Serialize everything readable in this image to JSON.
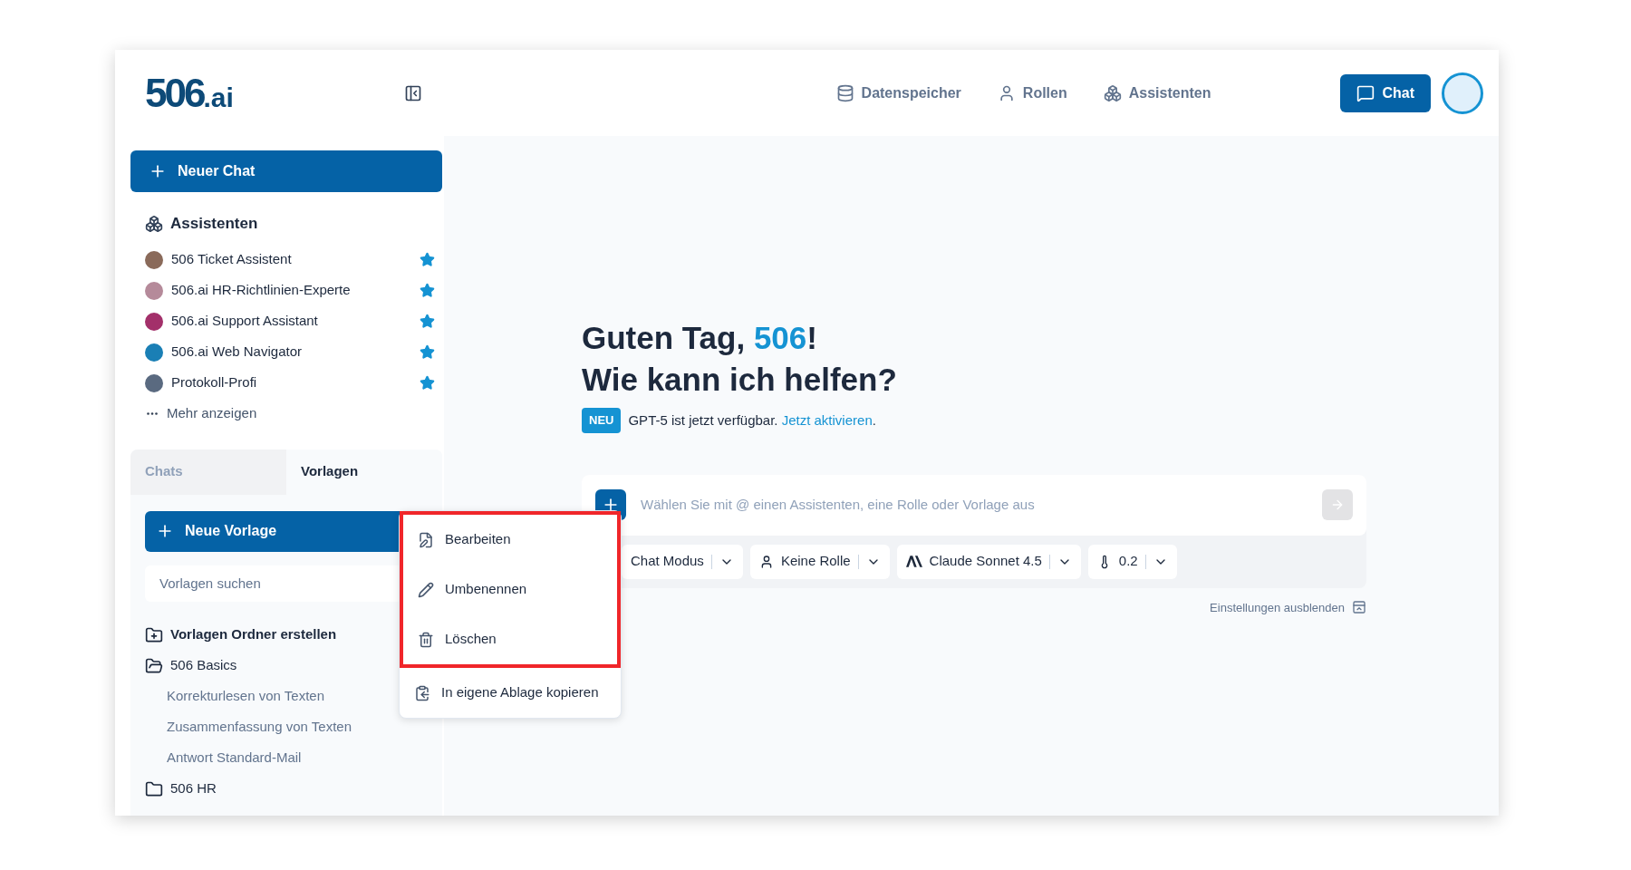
{
  "header": {
    "logo_main": "506",
    "logo_suffix": ".ai",
    "nav": [
      {
        "label": "Datenspeicher"
      },
      {
        "label": "Rollen"
      },
      {
        "label": "Assistenten"
      }
    ],
    "chat_button": "Chat"
  },
  "sidebar": {
    "new_chat": "Neuer Chat",
    "assistants_title": "Assistenten",
    "assistants": [
      {
        "name": "506 Ticket Assistent",
        "color": "#8a6a5a",
        "favorite": true
      },
      {
        "name": "506.ai HR-Richtlinien-Experte",
        "color": "#b58a9a",
        "favorite": true
      },
      {
        "name": "506.ai Support Assistant",
        "color": "#a3306a",
        "favorite": true
      },
      {
        "name": "506.ai Web Navigator",
        "color": "#1a7fb5",
        "favorite": true
      },
      {
        "name": "Protokoll-Profi",
        "color": "#5a6a80",
        "favorite": true
      }
    ],
    "more": "Mehr anzeigen",
    "tabs": [
      {
        "label": "Chats",
        "selected": false
      },
      {
        "label": "Vorlagen",
        "selected": true
      }
    ],
    "new_template": "Neue Vorlage",
    "search": {
      "placeholder": "Vorlagen suchen"
    },
    "create_folder": "Vorlagen Ordner erstellen",
    "folders": [
      {
        "label": "506 Basics",
        "expanded": true,
        "children": [
          {
            "label": "Korrekturlesen von Texten"
          },
          {
            "label": "Zusammenfassung von Texten"
          },
          {
            "label": "Antwort Standard-Mail"
          }
        ]
      },
      {
        "label": "506 HR",
        "expanded": false
      }
    ]
  },
  "main": {
    "greeting_prefix": "Guten Tag, ",
    "greeting_name": "506",
    "greeting_suffix": "!",
    "subtitle": "Wie kann ich helfen?",
    "notice": {
      "badge": "NEU",
      "text": "GPT-5 ist jetzt verfügbar. ",
      "link": "Jetzt aktivieren",
      "end": "."
    },
    "input": {
      "placeholder": "Wählen Sie mit @ einen Assistenten, eine Rolle oder Vorlage aus"
    },
    "settings": [
      {
        "label": "Chat Modus"
      },
      {
        "label": "Keine Rolle"
      },
      {
        "label": "Claude Sonnet 4.5"
      },
      {
        "label": "0.2"
      }
    ],
    "hide_settings": "Einstellungen ausblenden"
  },
  "context_menu": [
    {
      "label": "Bearbeiten",
      "highlighted": true
    },
    {
      "label": "Umbenennen",
      "highlighted": true
    },
    {
      "label": "Löschen",
      "highlighted": true
    },
    {
      "label": "In eigene Ablage kopieren",
      "highlighted": false
    }
  ]
}
